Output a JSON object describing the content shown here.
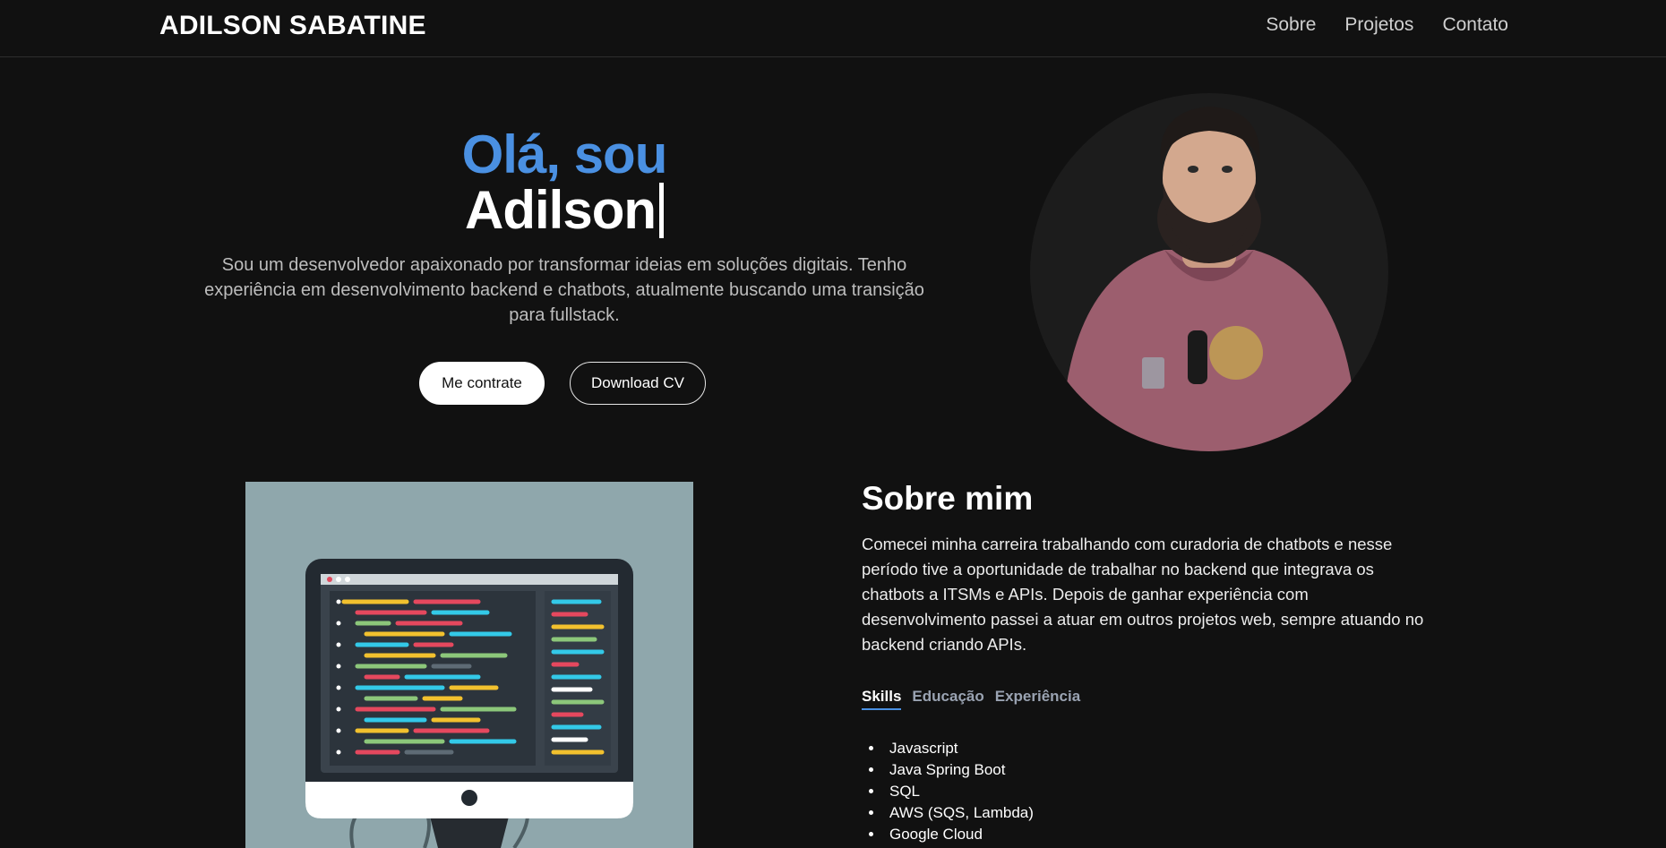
{
  "header": {
    "brand": "ADILSON SABATINE",
    "nav": [
      "Sobre",
      "Projetos",
      "Contato"
    ]
  },
  "hero": {
    "greeting": "Olá, sou",
    "name": "Adilson",
    "description": "Sou um desenvolvedor apaixonado por transformar ideias em soluções digitais. Tenho experiência em desenvolvimento backend e chatbots, atualmente buscando uma transição para fullstack.",
    "primary_button": "Me contrate",
    "secondary_button": "Download CV"
  },
  "about": {
    "title": "Sobre mim",
    "text": "Comecei minha carreira trabalhando com curadoria de chatbots e nesse período tive a oportunidade de trabalhar no backend que integrava os chatbots a ITSMs e APIs. Depois de ganhar experiência com desenvolvimento passei a atuar em outros projetos web, sempre atuando no backend criando APIs.",
    "tabs": [
      "Skills",
      "Educação",
      "Experiência"
    ],
    "active_tab": "Skills",
    "skills": [
      "Javascript",
      "Java Spring Boot",
      "SQL",
      "AWS (SQS, Lambda)",
      "Google Cloud"
    ]
  },
  "colors": {
    "background": "#111111",
    "accent": "#4a90e2",
    "text_muted": "#bdbdbd"
  }
}
